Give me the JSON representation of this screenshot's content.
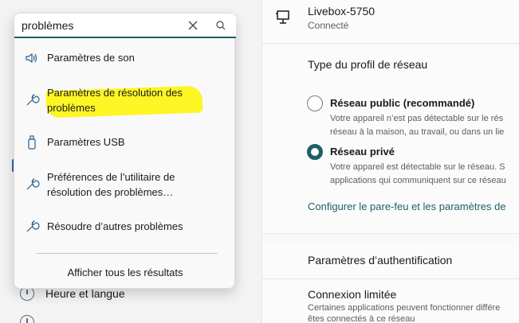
{
  "search": {
    "value": "problèmes",
    "results": [
      {
        "label": "Paramètres de son",
        "icon": "speaker-icon"
      },
      {
        "label": "Paramètres de résolution des problèmes",
        "icon": "wrench-icon"
      },
      {
        "label": "Paramètres USB",
        "icon": "usb-drive-icon"
      },
      {
        "label": "Préférences de l’utilitaire de résolution des problèmes…",
        "icon": "wrench-icon"
      },
      {
        "label": "Résoudre d’autres problèmes",
        "icon": "wrench-icon"
      }
    ],
    "show_all": "Afficher tous les résultats"
  },
  "sidebar": {
    "items": [
      {
        "label": "Heure et langue",
        "icon": "clock-globe-icon"
      }
    ]
  },
  "network": {
    "name": "Livebox-5750",
    "status": "Connecté",
    "profile_title": "Type du profil de réseau",
    "public": {
      "label": "Réseau public (recommandé)",
      "desc1": "Votre appareil n’est pas détectable sur le rés",
      "desc2": "réseau à la maison, au travail, ou dans un lie"
    },
    "private": {
      "label": "Réseau privé",
      "desc1": "Votre appareil est détectable sur le réseau. S",
      "desc2": "applications qui communiquent sur ce réseau"
    },
    "firewall_link": "Configurer le pare-feu et les paramètres de",
    "auth_label": "Paramètres d’authentification",
    "metered_label": "Connexion limitée",
    "metered_desc1": "Certaines applications peuvent fonctionner différe",
    "metered_desc2": "êtes connectés à ce réseau"
  },
  "colors": {
    "accent": "#1f5f66",
    "highlight": "#fff500"
  }
}
